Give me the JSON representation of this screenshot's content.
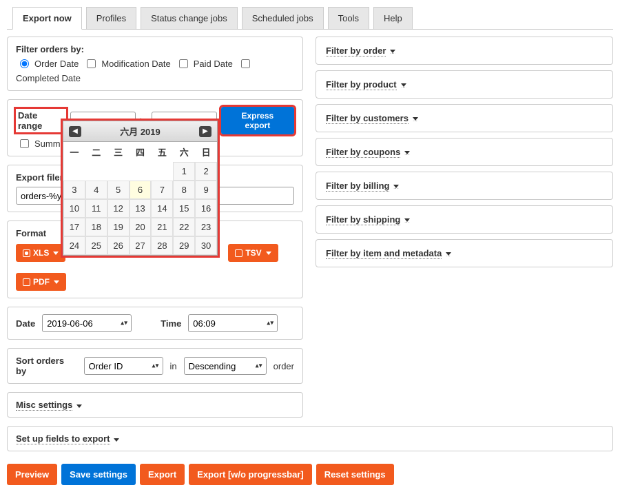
{
  "tabs": [
    "Export now",
    "Profiles",
    "Status change jobs",
    "Scheduled jobs",
    "Tools",
    "Help"
  ],
  "filter": {
    "heading": "Filter orders by:",
    "opts": [
      "Order Date",
      "Modification Date",
      "Paid Date",
      "Completed Date"
    ]
  },
  "dateRange": {
    "label": "Date range",
    "to": "to",
    "summary": "Summary",
    "express": "Express export"
  },
  "datepicker": {
    "title": "六月 2019",
    "dow": [
      "一",
      "二",
      "三",
      "四",
      "五",
      "六",
      "日"
    ],
    "leadingBlanks": 5,
    "days": 30,
    "today": 6
  },
  "filename": {
    "label": "Export filen",
    "value": "orders-%y-"
  },
  "format": {
    "heading": "Format",
    "chips": [
      {
        "name": "XLS",
        "checked": true
      },
      {
        "name": "TSV",
        "checked": false
      },
      {
        "name": "PDF",
        "checked": false
      }
    ]
  },
  "datetime": {
    "dateLabel": "Date",
    "dateValue": "2019-06-06",
    "timeLabel": "Time",
    "timeValue": "06:09"
  },
  "sort": {
    "label": "Sort orders by",
    "field": "Order ID",
    "in": "in",
    "dir": "Descending",
    "order": "order"
  },
  "misc": "Misc settings",
  "setup": "Set up fields to export",
  "rightFilters": [
    "Filter by order",
    "Filter by product",
    "Filter by customers",
    "Filter by coupons",
    "Filter by billing",
    "Filter by shipping",
    "Filter by item and metadata"
  ],
  "bottom": [
    "Preview",
    "Save settings",
    "Export",
    "Export [w/o progressbar]",
    "Reset settings"
  ]
}
